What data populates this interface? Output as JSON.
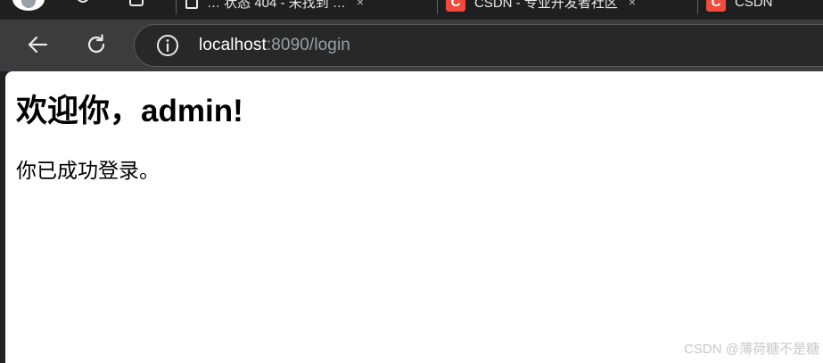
{
  "browser": {
    "tabs": [
      {
        "title": "… 状态 404 - 未找到 …",
        "icon": "document-icon"
      },
      {
        "title": "CSDN - 专业开发者社区",
        "icon": "csdn-icon"
      },
      {
        "title": "CSDN",
        "icon": "csdn-icon"
      }
    ],
    "tab_close_glyph": "×",
    "csdn_favicon_letter": "C",
    "address_bar": {
      "host": "localhost",
      "rest": ":8090/login"
    },
    "toolbar_icons": [
      "back-arrow-icon",
      "reload-icon",
      "site-info-icon"
    ]
  },
  "page": {
    "heading": "欢迎你，admin!",
    "message": "你已成功登录。"
  },
  "watermark": "CSDN @薄荷糖不是糖",
  "colors": {
    "toolbar": "#3c3c3c",
    "omnibox": "#282828",
    "csdn_red": "#f04b3e",
    "page_bg": "#ffffff"
  }
}
